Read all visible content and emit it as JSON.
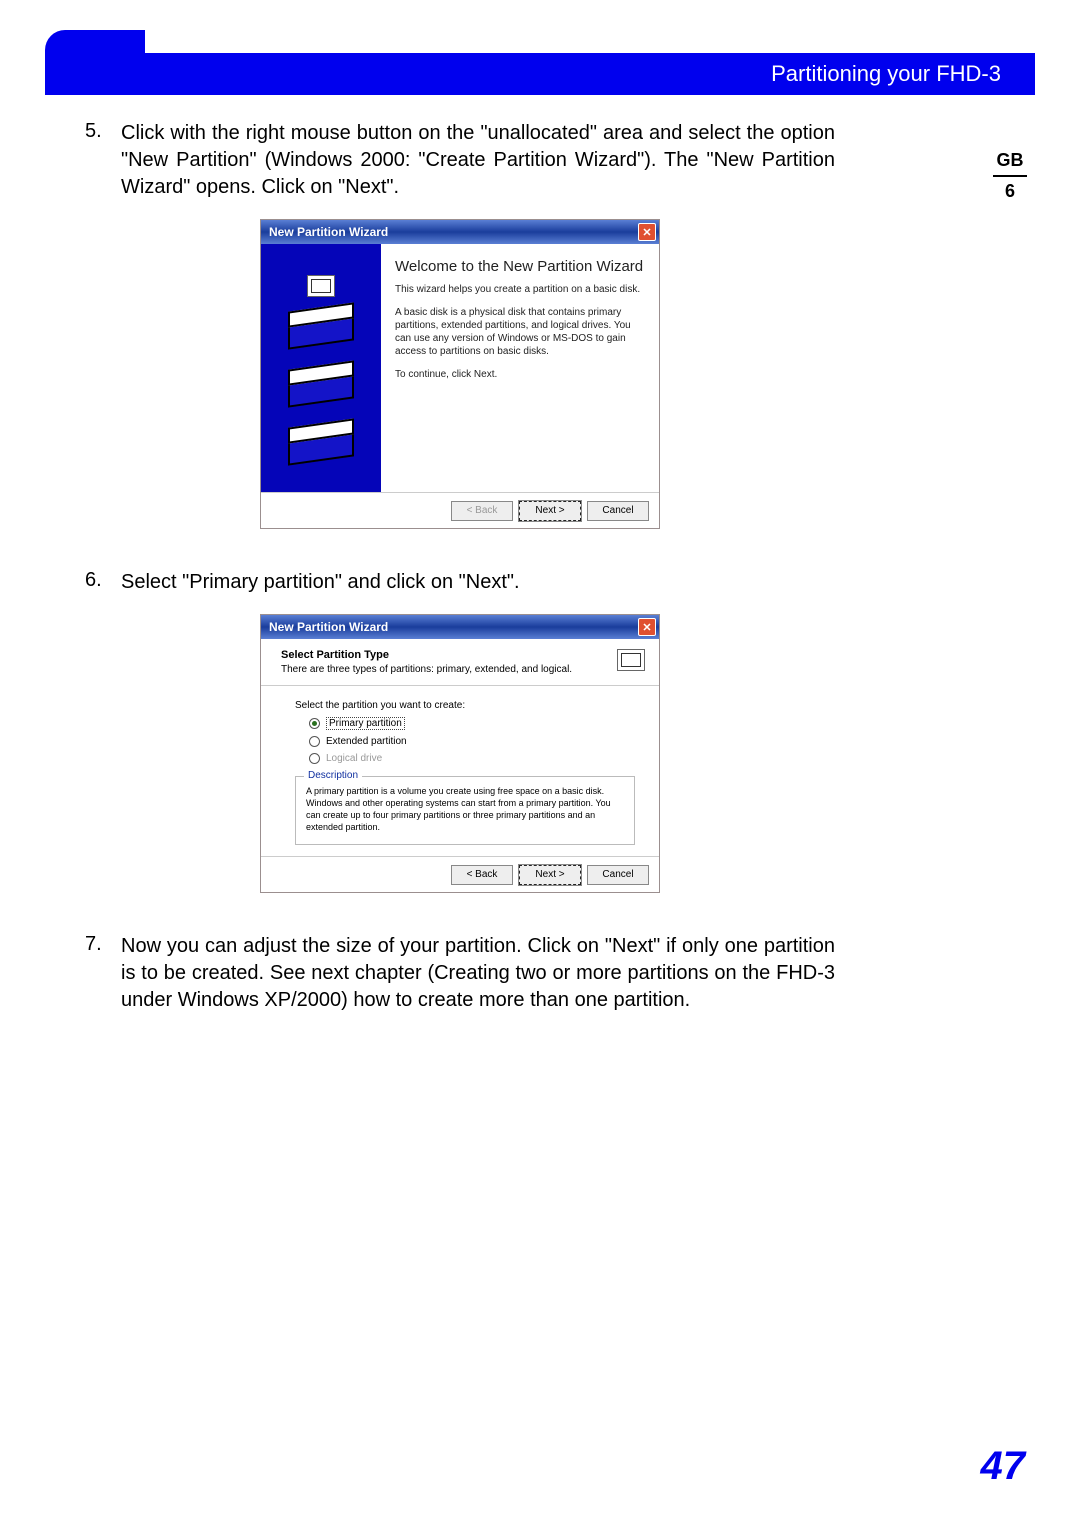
{
  "header": {
    "title": "Partitioning your FHD-3"
  },
  "sidetab": {
    "top": "GB",
    "bottom": "6"
  },
  "steps": {
    "s5": {
      "num": "5.",
      "text": "Click with the right mouse button on the \"unallocated\" area and select the option \"New Partition\" (Windows 2000: \"Create Partition Wizard\"). The \"New Partition Wizard\" opens. Click on \"Next\"."
    },
    "s6": {
      "num": "6.",
      "text": "Select \"Primary partition\" and click on \"Next\"."
    },
    "s7": {
      "num": "7.",
      "text": "Now you can adjust the size of your partition. Click on \"Next\" if only one partition is to be created. See next chapter (Creating two or more partitions on the FHD-3 under Windows XP/2000) how to create more than one partition."
    }
  },
  "dlg1": {
    "title": "New Partition Wizard",
    "heading": "Welcome to the New Partition Wizard",
    "p1": "This wizard helps you create a partition on a basic disk.",
    "p2": "A basic disk is a physical disk that contains primary partitions, extended partitions, and logical drives. You can use any version of Windows or MS-DOS to gain access to partitions on basic disks.",
    "p3": "To continue, click Next.",
    "back": "< Back",
    "next": "Next >",
    "cancel": "Cancel"
  },
  "dlg2": {
    "title": "New Partition Wizard",
    "hdr_t": "Select Partition Type",
    "hdr_s": "There are three types of partitions: primary, extended, and logical.",
    "prompt": "Select the partition you want to create:",
    "opt1": "Primary partition",
    "opt2": "Extended partition",
    "opt3": "Logical drive",
    "desc_lbl": "Description",
    "desc_txt": "A primary partition is a volume you create using free space on a basic disk. Windows and other operating systems can start from a primary partition. You can create up to four primary partitions or three primary partitions and an extended partition.",
    "back": "< Back",
    "next": "Next >",
    "cancel": "Cancel"
  },
  "page_number": "47"
}
